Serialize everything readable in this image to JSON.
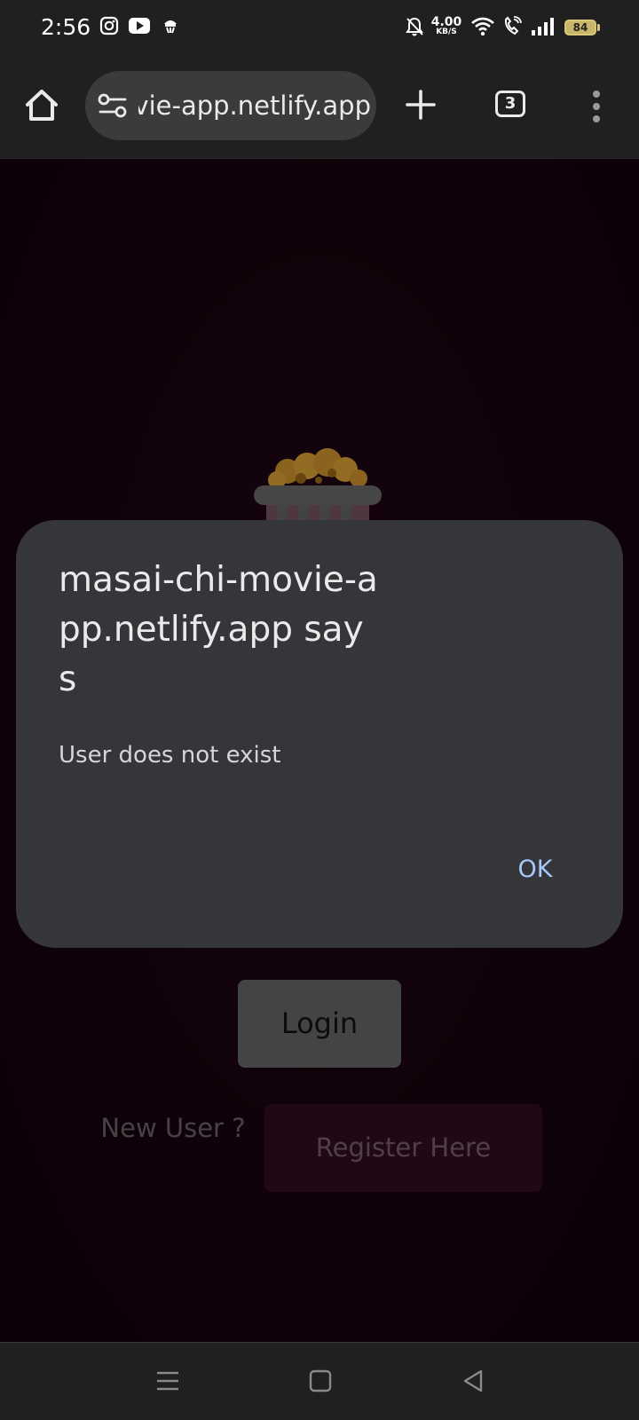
{
  "status_bar": {
    "time": "2:56",
    "net_speed_value": "4.00",
    "net_speed_unit": "KB/S",
    "battery_level": "84"
  },
  "browser": {
    "url": "masai-chi-movie-app.netlify.app",
    "tab_count": "3"
  },
  "page": {
    "login_label": "Login",
    "new_user_label": "New User ?",
    "register_label": "Register Here"
  },
  "dialog": {
    "title": "masai-chi-movie-app.netlify.app says",
    "message": "User does not exist",
    "ok_label": "OK"
  },
  "colors": {
    "page_background": "#15020d",
    "dialog_background": "#35363a",
    "accent_link": "#a8c7fa",
    "battery": "#c9b66a"
  }
}
